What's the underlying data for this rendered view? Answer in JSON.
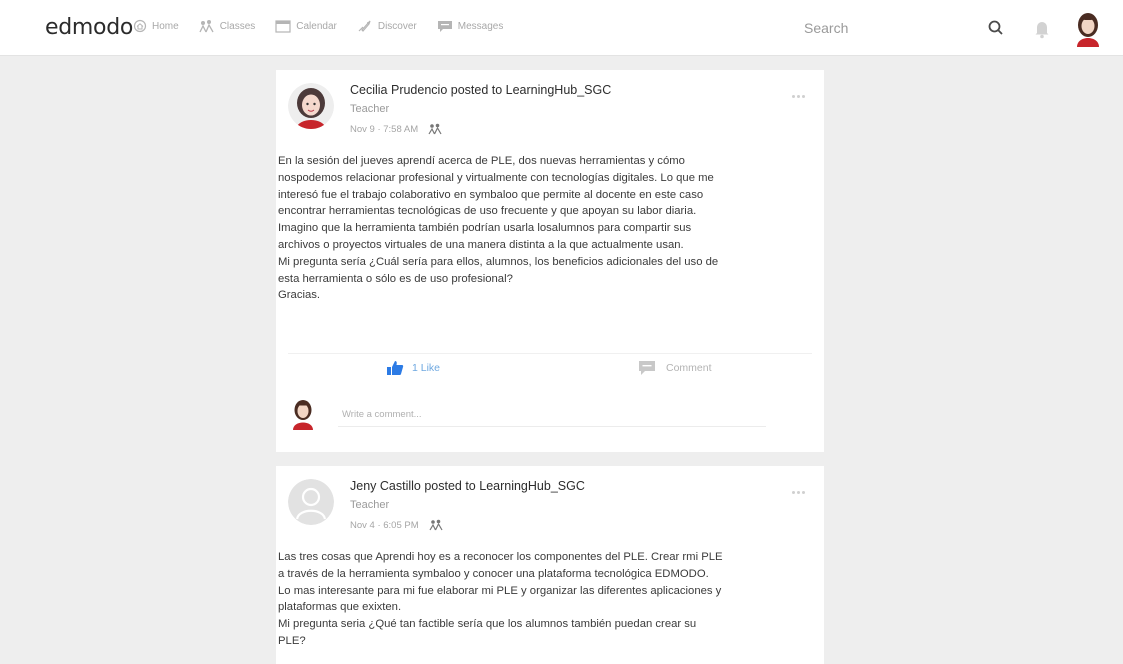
{
  "app": {
    "logo": "edmodo"
  },
  "nav": [
    {
      "label": "Home",
      "icon": "home-icon"
    },
    {
      "label": "Classes",
      "icon": "classes-icon"
    },
    {
      "label": "Calendar",
      "icon": "calendar-icon"
    },
    {
      "label": "Discover",
      "icon": "discover-icon"
    },
    {
      "label": "Messages",
      "icon": "messages-icon"
    }
  ],
  "search": {
    "placeholder": "Search",
    "icon": "search-icon"
  },
  "colors": {
    "accent": "#2c7be5",
    "like": "#2c7be5",
    "background": "#eeeeee",
    "avatar_red": "#c7252b"
  },
  "posts": [
    {
      "author_line": "Cecilia Prudencio posted to LearningHub_SGC",
      "role": "Teacher",
      "date": "Nov 9 · 7:58 AM",
      "body": [
        "En la sesión del jueves aprendí acerca de PLE, dos nuevas herramientas y  cómo",
        "nospodemos relacionar profesional y virtualmente con tecnologías digitales. Lo que me",
        "interesó fue el trabajo colaborativo en symbaloo que permite al docente en este caso",
        "encontrar herramientas tecnológicas de uso frecuente y que apoyan su labor diaria.",
        "Imagino que la herramienta también podrían usarla losalumnos para compartir sus",
        "archivos o proyectos virtuales de una manera distinta a la que actualmente usan.",
        "Mi pregunta sería ¿Cuál sería para ellos, alumnos, los beneficios adicionales del uso de",
        "esta herramienta o sólo es de uso profesional?",
        "Gracias."
      ],
      "like_label": "1 Like",
      "comment_label": "Comment",
      "comment_placeholder": "Write a comment..."
    },
    {
      "author_line": "Jeny Castillo posted to LearningHub_SGC",
      "role": "Teacher",
      "date": "Nov 4 · 6:05 PM",
      "body": [
        "Las tres cosas que Aprendi hoy es a reconocer los componentes del PLE. Crear rmi PLE",
        "a través de la herramienta symbaloo y conocer una plataforma tecnológica EDMODO.",
        "Lo mas interesante para mi fue  elaborar mi PLE y organizar las diferentes aplicaciones y",
        "plataformas que exixten.",
        "Mi pregunta seria ¿Qué tan factible sería que los alumnos también puedan crear su",
        "PLE?"
      ]
    }
  ]
}
